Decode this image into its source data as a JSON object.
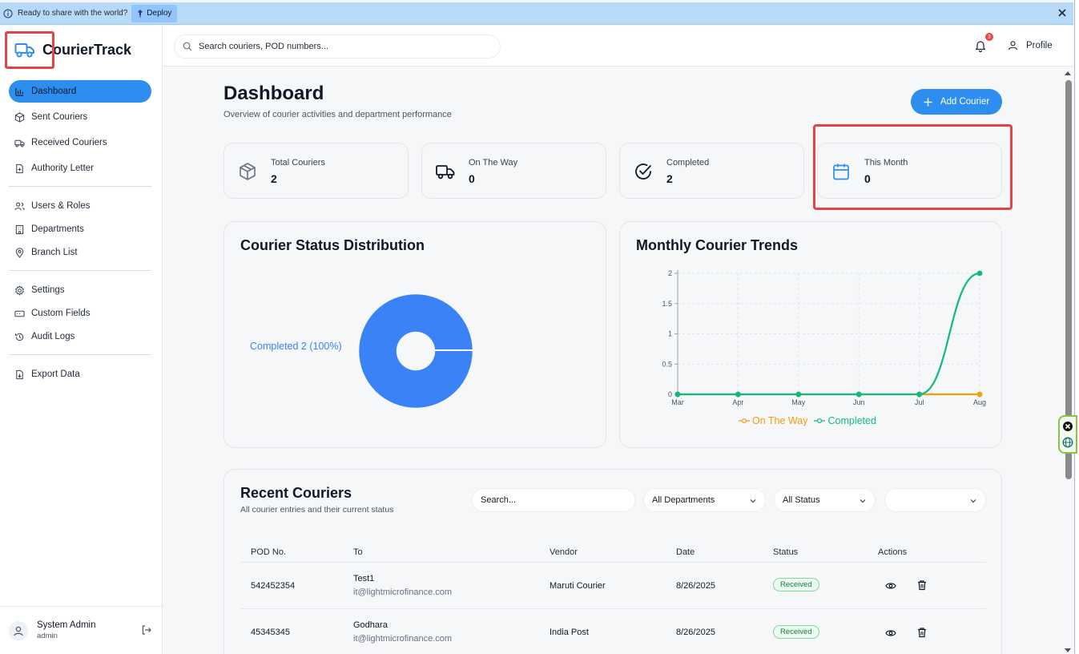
{
  "topbar": {
    "message": "Ready to share with the world?",
    "deploy_label": "Deploy"
  },
  "app": {
    "name": "CourierTrack"
  },
  "sidebar": {
    "groups": [
      [
        {
          "label": "Dashboard",
          "icon": "bar-chart-icon",
          "active": true
        },
        {
          "label": "Sent Couriers",
          "icon": "package-icon"
        },
        {
          "label": "Received Couriers",
          "icon": "truck-icon"
        },
        {
          "label": "Authority Letter",
          "icon": "file-plus-icon"
        }
      ],
      [
        {
          "label": "Users & Roles",
          "icon": "users-icon"
        },
        {
          "label": "Departments",
          "icon": "building-icon"
        },
        {
          "label": "Branch List",
          "icon": "map-pin-icon"
        }
      ],
      [
        {
          "label": "Settings",
          "icon": "gear-icon"
        },
        {
          "label": "Custom Fields",
          "icon": "input-field-icon"
        },
        {
          "label": "Audit Logs",
          "icon": "history-icon"
        }
      ],
      [
        {
          "label": "Export Data",
          "icon": "file-export-icon"
        }
      ]
    ],
    "user": {
      "name": "System Admin",
      "role": "admin"
    }
  },
  "header": {
    "search_placeholder": "Search couriers, POD numbers...",
    "notification_count": "3",
    "profile_label": "Profile"
  },
  "dashboard": {
    "title": "Dashboard",
    "subtitle": "Overview of courier activities and department performance",
    "add_button": "Add Courier",
    "stats": [
      {
        "label": "Total Couriers",
        "value": "2",
        "icon": "package-icon"
      },
      {
        "label": "On The Way",
        "value": "0",
        "icon": "truck-icon"
      },
      {
        "label": "Completed",
        "value": "2",
        "icon": "check-circle-icon"
      },
      {
        "label": "This Month",
        "value": "0",
        "icon": "calendar-icon"
      }
    ]
  },
  "charts": {
    "pie_title": "Courier Status Distribution",
    "pie_label": "Completed 2 (100%)",
    "line_title": "Monthly Courier Trends"
  },
  "chart_data": [
    {
      "type": "pie",
      "title": "Courier Status Distribution",
      "slices": [
        {
          "name": "Completed",
          "value": 2,
          "percent": 100,
          "color": "#3b82f6"
        }
      ],
      "donut": true
    },
    {
      "type": "line",
      "title": "Monthly Courier Trends",
      "categories": [
        "Mar",
        "Apr",
        "May",
        "Jun",
        "Jul",
        "Aug"
      ],
      "ylim": [
        0,
        2
      ],
      "yticks": [
        "0",
        "0.5",
        "1",
        "1.5",
        "2"
      ],
      "grid": true,
      "legend_position": "bottom",
      "series": [
        {
          "name": "On The Way",
          "color": "#f59e0b",
          "values": [
            0,
            0,
            0,
            0,
            0,
            0
          ]
        },
        {
          "name": "Completed",
          "color": "#10b981",
          "values": [
            0,
            0,
            0,
            0,
            0,
            2
          ]
        }
      ]
    }
  ],
  "recent": {
    "title": "Recent Couriers",
    "subtitle": "All courier entries and their current status",
    "search_placeholder": "Search...",
    "dept_filter": "All Departments",
    "status_filter": "All Status",
    "third_filter": "",
    "columns": [
      "POD No.",
      "To",
      "Vendor",
      "Date",
      "Status",
      "Actions"
    ],
    "rows": [
      {
        "pod": "542452354",
        "to": "Test1",
        "email": "it@lightmicrofinance.com",
        "vendor": "Maruti Courier",
        "date": "8/26/2025",
        "status": "Received"
      },
      {
        "pod": "45345345",
        "to": "Godhara",
        "email": "it@lightmicrofinance.com",
        "vendor": "India Post",
        "date": "8/26/2025",
        "status": "Received"
      }
    ]
  }
}
